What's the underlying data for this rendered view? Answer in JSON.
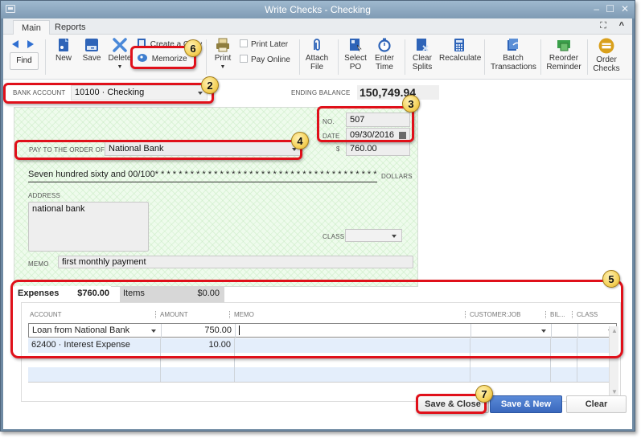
{
  "window": {
    "title": "Write Checks - Checking",
    "controls": {
      "minimize": "–",
      "maximize": "☐",
      "close": "✕"
    }
  },
  "ribbon": {
    "tabs": [
      {
        "label": "Main",
        "active": true
      },
      {
        "label": "Reports",
        "active": false
      }
    ],
    "right_icons": {
      "expand": "⛶",
      "collapse": "^"
    }
  },
  "toolbar": {
    "find": "Find",
    "new": "New",
    "save": "Save",
    "delete": "Delete",
    "create_copy": "Create a Copy",
    "memorize": "Memorize",
    "print": "Print",
    "print_later": "Print Later",
    "pay_online": "Pay Online",
    "attach_file": [
      "Attach",
      "File"
    ],
    "select_po": [
      "Select",
      "PO"
    ],
    "enter_time": [
      "Enter",
      "Time"
    ],
    "clear_splits": [
      "Clear",
      "Splits"
    ],
    "recalculate": "Recalculate",
    "batch_transactions": [
      "Batch",
      "Transactions"
    ],
    "reorder_reminder": [
      "Reorder",
      "Reminder"
    ],
    "order_checks": [
      "Order",
      "Checks"
    ]
  },
  "header": {
    "bank_account_label": "BANK ACCOUNT",
    "bank_account_value": "10100 · Checking",
    "ending_balance_label": "ENDING BALANCE",
    "ending_balance_value": "150,749.94"
  },
  "check": {
    "no_label": "NO.",
    "no_value": "507",
    "date_label": "DATE",
    "date_value": "09/30/2016",
    "pay_to_label": "PAY TO THE ORDER OF",
    "pay_to_value": "National Bank",
    "dollar_sign": "$",
    "amount": "760.00",
    "amount_words": "Seven hundred sixty and 00/100* * * * * * * * * * * * * * * * * * * * * * * * * * * * * * * * * * * * * * * * *",
    "dollars_label": "DOLLARS",
    "address_label": "ADDRESS",
    "address_value": "national bank",
    "class_label": "CLASS",
    "class_value": "",
    "memo_label": "MEMO",
    "memo_value": "first monthly payment"
  },
  "splits": {
    "tabs": [
      {
        "label": "Expenses",
        "amount": "$760.00",
        "active": true
      },
      {
        "label": "Items",
        "amount": "$0.00",
        "active": false
      }
    ],
    "columns": [
      "ACCOUNT",
      "AMOUNT",
      "MEMO",
      "CUSTOMER:JOB",
      "BIL...",
      "CLASS"
    ],
    "rows": [
      {
        "account": "Loan from National Bank",
        "amount": "750.00",
        "memo": "",
        "customer_job": "",
        "billable": "",
        "class": ""
      },
      {
        "account": "62400 · Interest Expense",
        "amount": "10.00",
        "memo": "",
        "customer_job": "",
        "billable": "",
        "class": ""
      },
      {
        "account": "",
        "amount": "",
        "memo": "",
        "customer_job": "",
        "billable": "",
        "class": ""
      },
      {
        "account": "",
        "amount": "",
        "memo": "",
        "customer_job": "",
        "billable": "",
        "class": ""
      }
    ]
  },
  "footer": {
    "save_close": "Save & Close",
    "save_new": "Save & New",
    "clear": "Clear"
  },
  "callouts": {
    "b2": "2",
    "b3": "3",
    "b4": "4",
    "b5": "5",
    "b6": "6",
    "b7": "7"
  },
  "colors": {
    "callout": "#e0101a",
    "primary_button": "#3d6fc4",
    "title_bar": "#8aa6bf",
    "check_bg": "#eefbec",
    "row_alt": "#e4eefb"
  }
}
